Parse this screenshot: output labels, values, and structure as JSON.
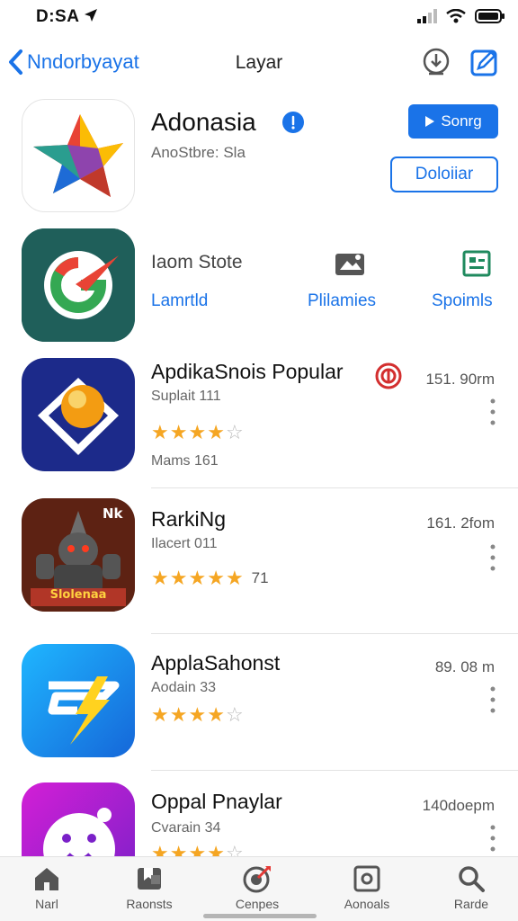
{
  "status": {
    "time": "D:SA"
  },
  "nav": {
    "back_label": "Nndorbyayat",
    "title": "Layar"
  },
  "featured": {
    "name": "Adonasia",
    "subtitle": "AnoStbre: Sla",
    "primary_button": "Sonrg",
    "secondary_button": "Doloiiar"
  },
  "store": {
    "title": "Iaom Stote",
    "links": [
      "Lamrtld",
      "Plilamies",
      "Spoimls"
    ]
  },
  "apps": [
    {
      "title": "ApdikaSnois Popular",
      "subtitle": "Suplait 111",
      "size": "151. 90rm",
      "rating": 3.5,
      "extra": "Mams 161",
      "rating_count": ""
    },
    {
      "title": "RarkiNg",
      "subtitle": "Ilacert 011",
      "size": "161. 2fom",
      "rating": 4.5,
      "rating_count": "71",
      "icon_text": "Slolenaa",
      "corner_text": "Nk"
    },
    {
      "title": "ApplaSahonst",
      "subtitle": "Aodain 33",
      "size": "89. 08 m",
      "rating": 3.5,
      "rating_count": ""
    },
    {
      "title": "Oppal Pnaylar",
      "subtitle": "Cvarain 34",
      "size": "140doepm",
      "rating": 3.5,
      "rating_count": ""
    }
  ],
  "tabs": [
    {
      "label": "Narl",
      "icon": "home-icon"
    },
    {
      "label": "Raonsts",
      "icon": "bookmark-icon"
    },
    {
      "label": "Cenpes",
      "icon": "games-icon"
    },
    {
      "label": "Aonoals",
      "icon": "apps-icon"
    },
    {
      "label": "Rarde",
      "icon": "search-icon"
    }
  ],
  "colors": {
    "accent": "#1a73e8",
    "star": "#f5a623"
  }
}
